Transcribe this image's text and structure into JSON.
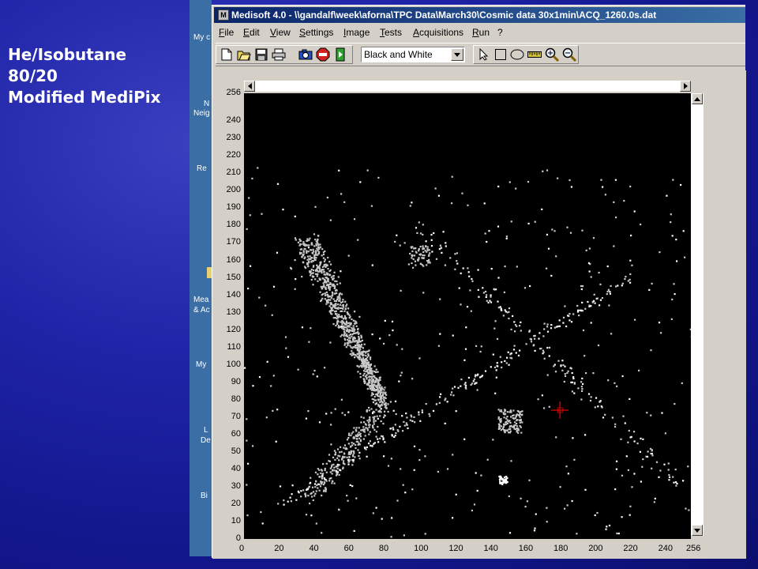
{
  "slide": {
    "caption_lines": [
      "He/Isobutane",
      "80/20",
      "Modified MediPix"
    ]
  },
  "desktop": {
    "icon_labels": [
      "My c",
      "N",
      "Neig",
      "Re",
      "Mea",
      "& Ac",
      "My",
      "L",
      "De",
      "Bi"
    ]
  },
  "window": {
    "title": "Medisoft 4.0 - \\\\gandalf\\week\\aforna\\TPC Data\\March30\\Cosmic data 30x1min\\ACQ_1260.0s.dat",
    "app_icon_glyph": "M"
  },
  "menu": [
    {
      "label": "File",
      "ul": "F"
    },
    {
      "label": "Edit",
      "ul": "E"
    },
    {
      "label": "View",
      "ul": "V"
    },
    {
      "label": "Settings",
      "ul": "S"
    },
    {
      "label": "Image",
      "ul": "I"
    },
    {
      "label": "Tests",
      "ul": "T"
    },
    {
      "label": "Acquisitions",
      "ul": "A"
    },
    {
      "label": "Run",
      "ul": "R"
    },
    {
      "label": "?",
      "ul": "?"
    }
  ],
  "toolbar": {
    "buttons": [
      "new-file-icon",
      "open-folder-icon",
      "save-icon",
      "print-icon",
      "camera-icon",
      "stop-icon",
      "run-icon"
    ],
    "colormap": "Black and White",
    "tools": [
      "select-arrow-icon",
      "rectangle-icon",
      "ellipse-icon",
      "ruler-icon",
      "zoom-in-icon",
      "zoom-out-icon"
    ]
  },
  "plot": {
    "y_ticks": [
      "256",
      "240",
      "230",
      "220",
      "210",
      "200",
      "190",
      "180",
      "170",
      "160",
      "150",
      "140",
      "130",
      "120",
      "110",
      "100",
      "90",
      "80",
      "70",
      "60",
      "50",
      "40",
      "30",
      "20",
      "10",
      "0"
    ],
    "x_ticks": [
      "0",
      "20",
      "40",
      "60",
      "80",
      "100",
      "120",
      "140",
      "160",
      "180",
      "200",
      "220",
      "240",
      "256"
    ],
    "range": [
      0,
      256
    ],
    "pixel_color": "#c8c8c8",
    "bright_color": "#ffffff",
    "cursor_color": "#c00000",
    "cursor_position": [
      181,
      74
    ]
  }
}
